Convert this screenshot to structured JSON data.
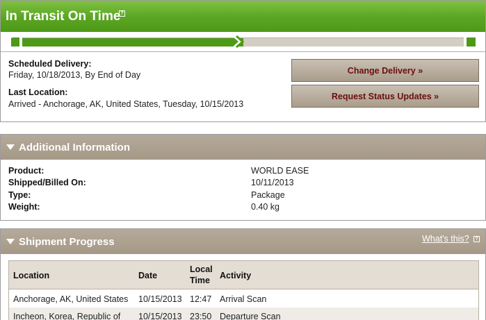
{
  "status": {
    "title": "In Transit On Time",
    "progress_percent": 50,
    "scheduled_label": "Scheduled Delivery:",
    "scheduled_value": "Friday, 10/18/2013, By End of Day",
    "last_location_label": "Last Location:",
    "last_location_value": "Arrived - Anchorage, AK, United States, Tuesday, 10/15/2013",
    "change_delivery_label": "Change Delivery »",
    "request_updates_label": "Request Status Updates »"
  },
  "additional": {
    "title": "Additional Information",
    "rows": [
      {
        "label": "Product:",
        "value": "WORLD EASE"
      },
      {
        "label": "Shipped/Billed On:",
        "value": "10/11/2013"
      },
      {
        "label": "Type:",
        "value": "Package"
      },
      {
        "label": "Weight:",
        "value": "0.40 kg"
      }
    ]
  },
  "progress": {
    "title": "Shipment Progress",
    "whats_this": "What's this?",
    "columns": {
      "location": "Location",
      "date": "Date",
      "time_line1": "Local",
      "time_line2": "Time",
      "activity": "Activity"
    },
    "rows": [
      {
        "location": "Anchorage, AK, United States",
        "date": "10/15/2013",
        "time": "12:47",
        "activity": "Arrival Scan"
      },
      {
        "location": "Incheon, Korea, Republic of",
        "date": "10/15/2013",
        "time": "23:50",
        "activity": "Departure Scan"
      }
    ]
  },
  "colors": {
    "status_green": "#5aa522",
    "section_tan": "#a59886",
    "button_text": "#6b0f0f"
  }
}
